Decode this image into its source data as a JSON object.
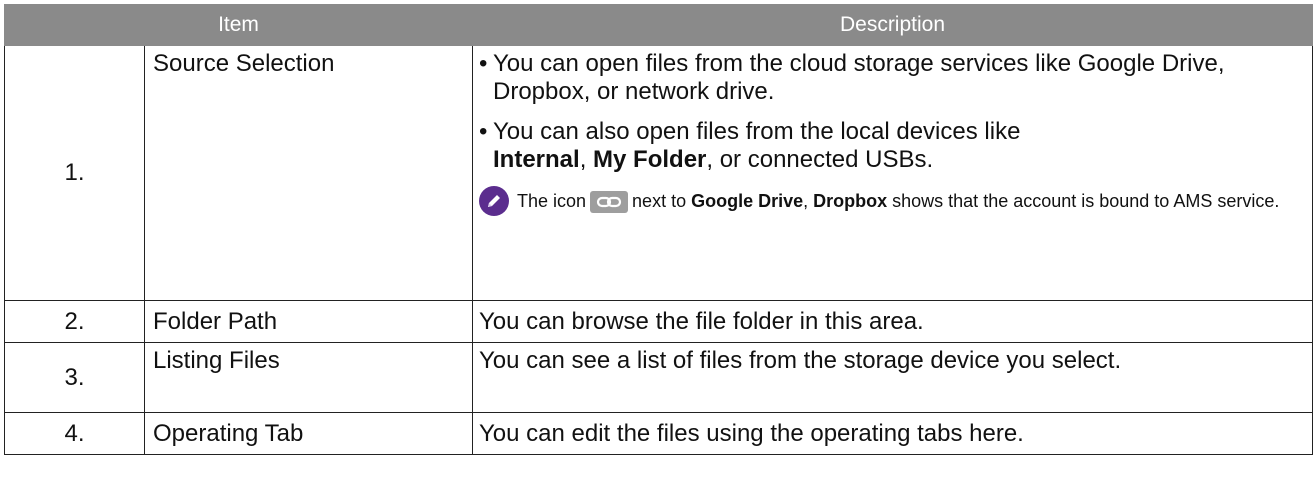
{
  "header": {
    "item": "Item",
    "description": "Description"
  },
  "rows": [
    {
      "number": "1.",
      "item": "Source Selection",
      "bullet_1": "You can open files from the cloud storage services like Google Drive, Dropbox, or network drive.",
      "bullet_2_pre": "You can also open files from the local devices like ",
      "bullet_2_bold_1": "Internal",
      "bullet_2_sep": ", ",
      "bullet_2_bold_2": "My Folder",
      "bullet_2_post": ", or connected USBs.",
      "note_pre": "The icon",
      "note_mid": "next to ",
      "note_bold_1": "Google Drive",
      "note_sep": ", ",
      "note_bold_2": "Dropbox",
      "note_post": " shows that the account is bound to AMS service."
    },
    {
      "number": "2.",
      "item": "Folder Path",
      "description": "You can browse the file folder in this area."
    },
    {
      "number": "3.",
      "item": "Listing Files",
      "description": "You can see a list of files from the storage device you select."
    },
    {
      "number": "4.",
      "item": "Operating Tab",
      "description": "You can edit the files using the operating tabs here."
    }
  ],
  "icons": {
    "note": "pencil-icon",
    "link": "link-icon"
  },
  "colors": {
    "header_bg": "#8a8a8a",
    "note_icon_bg": "#5b2d8e",
    "link_icon_bg": "#9e9e9e"
  }
}
